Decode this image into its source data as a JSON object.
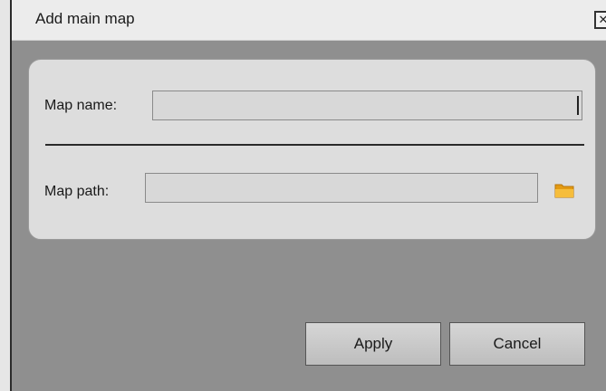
{
  "window": {
    "title": "Add main map",
    "close_glyph": "✕"
  },
  "form": {
    "map_name_label": "Map name:",
    "map_name_value": "",
    "map_path_label": "Map path:",
    "map_path_value": "",
    "browse_icon": "folder-icon"
  },
  "buttons": {
    "apply_label": "Apply",
    "cancel_label": "Cancel"
  },
  "colors": {
    "background": "#8f8f8f",
    "panel": "#dddddd",
    "titlebar": "#ececec",
    "folder": "#f0a91c"
  }
}
